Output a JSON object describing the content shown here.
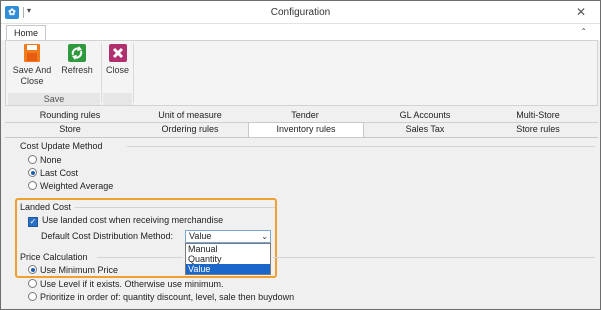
{
  "window": {
    "title": "Configuration",
    "icon": "app-icon",
    "close": "✕"
  },
  "ribbon": {
    "tab": "Home",
    "buttons": [
      {
        "label": "Save And Close",
        "icon": "save-close-icon"
      },
      {
        "label": "Refresh",
        "icon": "refresh-icon"
      },
      {
        "label": "Close",
        "icon": "close-x-icon"
      }
    ],
    "group_label": "Save"
  },
  "tabs": {
    "top_row": [
      "Rounding rules",
      "Unit of measure",
      "Tender",
      "GL Accounts",
      "Multi-Store"
    ],
    "bottom_row": [
      "Store",
      "Ordering rules",
      "Inventory rules",
      "Sales Tax",
      "Store rules"
    ],
    "active": "Inventory rules"
  },
  "cost_update": {
    "label": "Cost Update Method",
    "options": [
      "None",
      "Last Cost",
      "Weighted Average"
    ],
    "selected": "Last Cost"
  },
  "landed_cost": {
    "label": "Landed Cost",
    "checkbox_label": "Use landed cost when receiving merchandise",
    "checked": true,
    "method_label": "Default Cost Distribution Method:",
    "method_value": "Value",
    "method_options": [
      "Manual",
      "Quantity",
      "Value"
    ],
    "highlight_color": "#f0a030"
  },
  "price_calc": {
    "label": "Price Calculation",
    "options": [
      "Use Minimum Price",
      "Use Level if it exists. Otherwise use minimum.",
      "Prioritize in order of: quantity discount, level, sale then buydown"
    ],
    "selected": "Use Minimum Price"
  }
}
